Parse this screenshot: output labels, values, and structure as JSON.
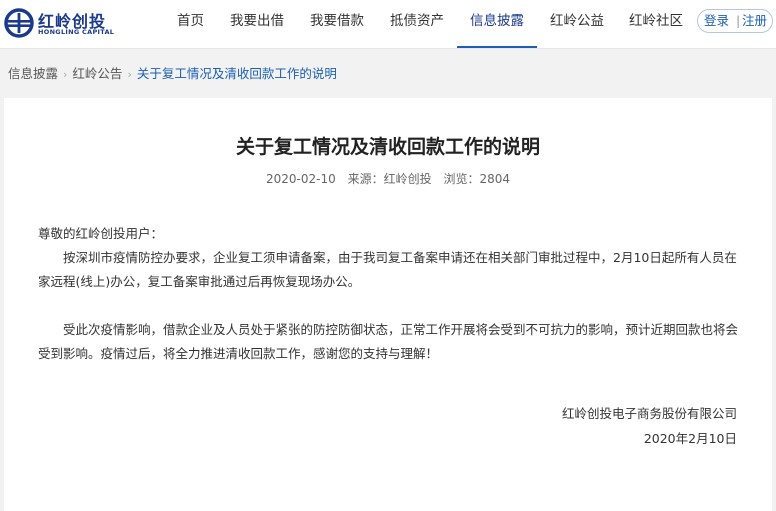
{
  "header": {
    "logo_cn": "红岭创投",
    "logo_en": "HONGLING CAPITAL",
    "brand_color": "#1b3a8c",
    "nav": [
      {
        "label": "首页"
      },
      {
        "label": "我要出借"
      },
      {
        "label": "我要借款"
      },
      {
        "label": "抵债资产"
      },
      {
        "label": "信息披露",
        "active": true
      },
      {
        "label": "红岭公益"
      },
      {
        "label": "红岭社区"
      }
    ],
    "login": "登录",
    "register": "注册",
    "separator": "|"
  },
  "breadcrumb": {
    "items": [
      "信息披露",
      "红岭公告"
    ],
    "current": "关于复工情况及清收回款工作的说明",
    "arrow": "›"
  },
  "article": {
    "title": "关于复工情况及清收回款工作的说明",
    "date": "2020-02-10",
    "source": "来源：红岭创投",
    "views": "浏览：2804",
    "greeting": "尊敬的红岭创投用户：",
    "paragraphs": [
      "按深圳市疫情防控办要求，企业复工须申请备案，由于我司复工备案申请还在相关部门审批过程中，2月10日起所有人员在家远程(线上)办公，复工备案审批通过后再恢复现场办公。",
      "受此次疫情影响，借款企业及人员处于紧张的防控防御状态，正常工作开展将会受到不可抗力的影响，预计近期回款也将会受到影响。疫情过后，将全力推进清收回款工作，感谢您的支持与理解！"
    ],
    "signature": "红岭创投电子商务股份有限公司",
    "sign_date": "2020年2月10日"
  }
}
